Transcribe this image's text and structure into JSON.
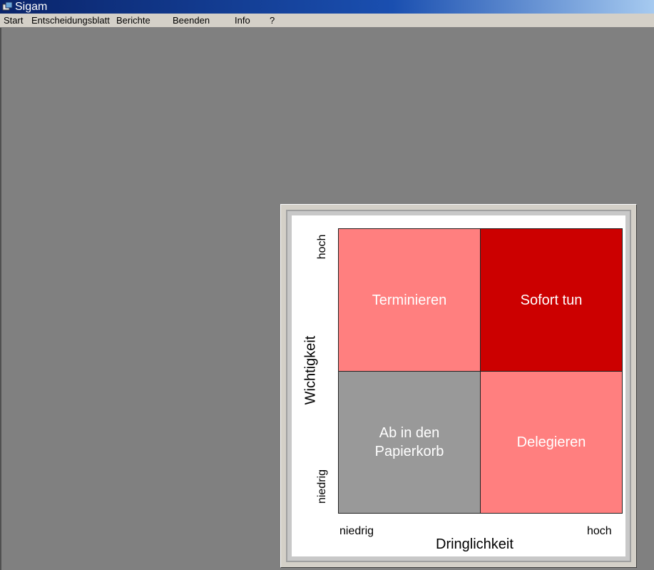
{
  "window": {
    "title": "Sigam"
  },
  "menu": [
    {
      "label": "Start"
    },
    {
      "label": "Entscheidungsblatt"
    },
    {
      "label": "Berichte"
    },
    {
      "label": "Beenden"
    },
    {
      "label": "Info"
    },
    {
      "label": "?"
    }
  ],
  "matrix": {
    "y_axis": {
      "label": "Wichtigkeit",
      "high": "hoch",
      "low": "niedrig"
    },
    "x_axis": {
      "label": "Dringlichkeit",
      "low": "niedrig",
      "high": "hoch"
    },
    "quadrants": {
      "top_left": {
        "label": "Terminieren",
        "color": "#ff7f7f"
      },
      "top_right": {
        "label": "Sofort tun",
        "color": "#cc0000"
      },
      "bottom_left": {
        "label_line1": "Ab in den",
        "label_line2": "Papierkorb",
        "color": "#999999"
      },
      "bottom_right": {
        "label": "Delegieren",
        "color": "#ff7f7f"
      }
    }
  },
  "colors": {
    "titlebar_start": "#0a246a",
    "workspace": "#808080",
    "menubar": "#d4d0c8"
  }
}
